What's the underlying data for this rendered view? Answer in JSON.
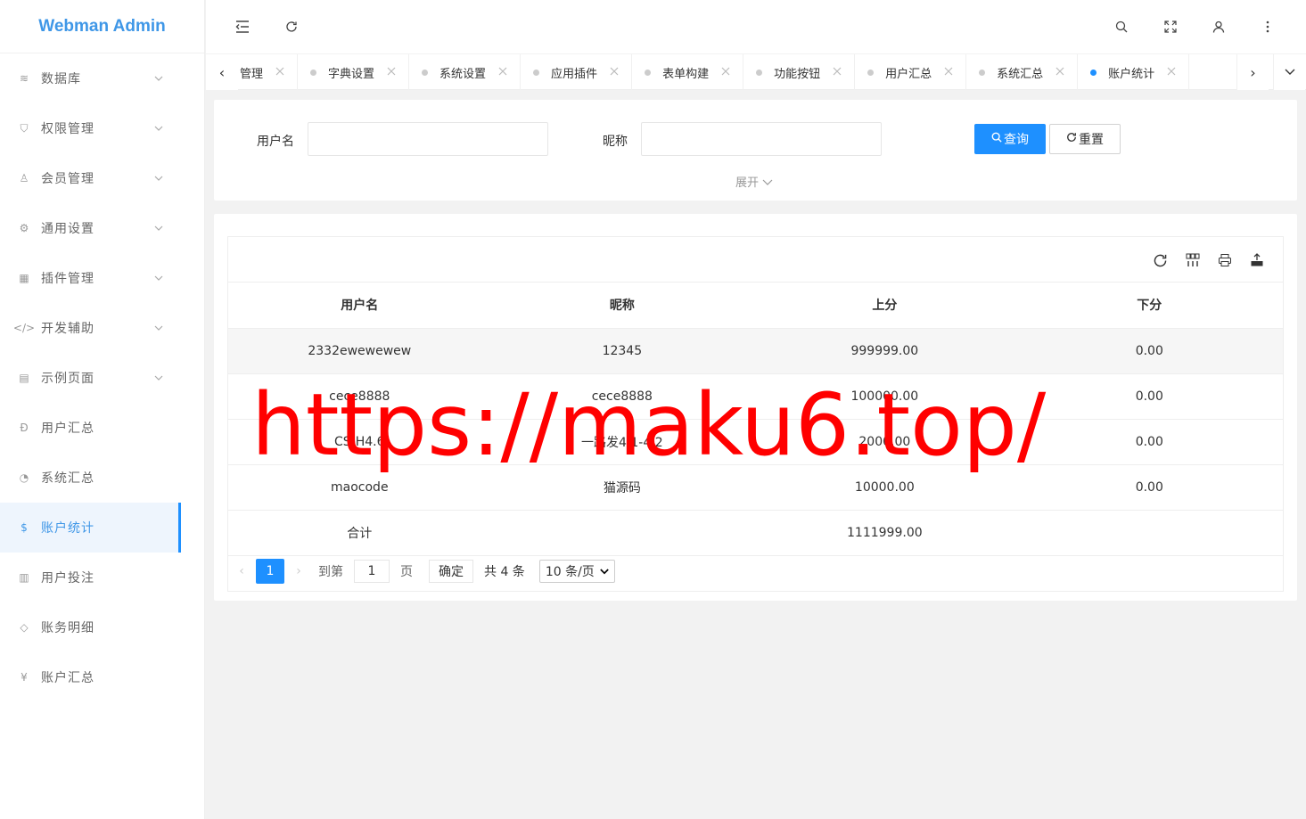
{
  "app": {
    "title": "Webman Admin"
  },
  "sidebar": {
    "items": [
      {
        "label": "数据库",
        "icon": "layers-icon",
        "glyph": "≋",
        "has_children": true
      },
      {
        "label": "权限管理",
        "icon": "shield-icon",
        "glyph": "⛉",
        "has_children": true
      },
      {
        "label": "会员管理",
        "icon": "user-icon",
        "glyph": "♙",
        "has_children": true
      },
      {
        "label": "通用设置",
        "icon": "gear-icon",
        "glyph": "⚙",
        "has_children": true
      },
      {
        "label": "插件管理",
        "icon": "apps-icon",
        "glyph": "▦",
        "has_children": true
      },
      {
        "label": "开发辅助",
        "icon": "code-icon",
        "glyph": "</>",
        "has_children": true
      },
      {
        "label": "示例页面",
        "icon": "template-icon",
        "glyph": "▤",
        "has_children": true
      },
      {
        "label": "用户汇总",
        "icon": "currency-icon",
        "glyph": "Đ",
        "has_children": false
      },
      {
        "label": "系统汇总",
        "icon": "dashboard-icon",
        "glyph": "◔",
        "has_children": false
      },
      {
        "label": "账户统计",
        "icon": "dollar-circle-icon",
        "glyph": "$",
        "has_children": false,
        "active": true
      },
      {
        "label": "用户投注",
        "icon": "receipt-icon",
        "glyph": "▥",
        "has_children": false
      },
      {
        "label": "账务明细",
        "icon": "diamond-icon",
        "glyph": "◇",
        "has_children": false
      },
      {
        "label": "账户汇总",
        "icon": "yen-circle-icon",
        "glyph": "¥",
        "has_children": false
      }
    ]
  },
  "header": {
    "icons": [
      "menu-fold-icon",
      "refresh-icon",
      "search-icon",
      "fullscreen-icon",
      "user-icon",
      "more-icon"
    ]
  },
  "tabs": {
    "items": [
      {
        "label": "管理",
        "active": false,
        "partial": true
      },
      {
        "label": "字典设置",
        "active": false
      },
      {
        "label": "系统设置",
        "active": false
      },
      {
        "label": "应用插件",
        "active": false
      },
      {
        "label": "表单构建",
        "active": false
      },
      {
        "label": "功能按钮",
        "active": false
      },
      {
        "label": "用户汇总",
        "active": false
      },
      {
        "label": "系统汇总",
        "active": false
      },
      {
        "label": "账户统计",
        "active": true
      }
    ]
  },
  "search": {
    "username_label": "用户名",
    "nickname_label": "昵称",
    "query_button": "查询",
    "reset_button": "重置",
    "expand_label": "展开"
  },
  "table": {
    "columns": [
      "用户名",
      "昵称",
      "上分",
      "下分"
    ],
    "rows": [
      {
        "username": "2332ewewewew",
        "nickname": "12345",
        "up": "999999.00",
        "down": "0.00"
      },
      {
        "username": "cece8888",
        "nickname": "cece8888",
        "up": "100000.00",
        "down": "0.00"
      },
      {
        "username": "CS-H4.6",
        "nickname": "一路发4.1-4.2",
        "up": "2000.00",
        "down": "0.00"
      },
      {
        "username": "maocode",
        "nickname": "猫源码",
        "up": "10000.00",
        "down": "0.00"
      }
    ],
    "total_label": "合计",
    "total_up": "1111999.00"
  },
  "pagination": {
    "current_page": "1",
    "goto_label": "到第",
    "goto_value": "1",
    "page_unit": "页",
    "confirm_label": "确定",
    "total_text": "共 4 条",
    "page_size": "10 条/页"
  },
  "watermark": {
    "text": "https://maku6.top/"
  }
}
